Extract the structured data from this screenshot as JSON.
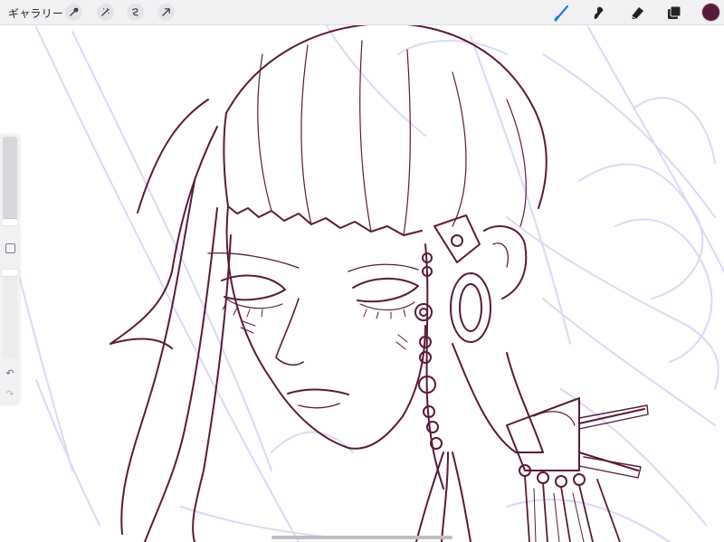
{
  "toolbar": {
    "gallery_label": "ギャラリー",
    "left_tools": [
      "wrench-icon",
      "magic-wand-icon",
      "selection-icon",
      "transform-arrow-icon"
    ],
    "right_tools": [
      "brush-icon",
      "smudge-icon",
      "eraser-icon",
      "layers-icon"
    ],
    "active_tool": "brush-icon",
    "accent_color": "#1e7ae6",
    "current_color": "#5a1a3a"
  },
  "sidebar": {
    "brush_size_level": 0.0,
    "opacity_level": 0.96,
    "modify_button": "modify-square-icon",
    "undo_icon": "undo-icon",
    "redo_icon": "redo-icon",
    "undo_glyph": "↶",
    "redo_glyph": "↷"
  },
  "canvas": {
    "line_color": "#5a1a3a",
    "sketch_color": "#d9daf6",
    "subject": "line-art-illustration"
  }
}
